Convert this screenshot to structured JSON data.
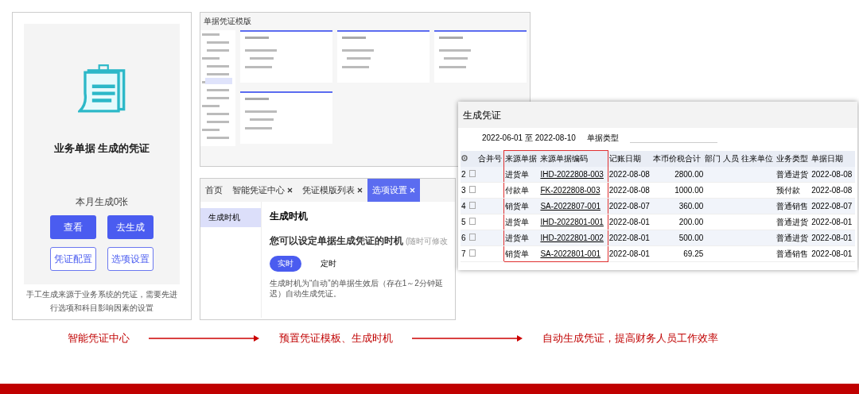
{
  "center_card": {
    "title": "业务单据 生成的凭证",
    "count": "本月生成0张",
    "buttons": [
      {
        "label": "查看",
        "kind": "primary"
      },
      {
        "label": "去生成",
        "kind": "primary"
      },
      {
        "label": "凭证配置",
        "kind": "outline"
      },
      {
        "label": "选项设置",
        "kind": "outline"
      }
    ],
    "note": "手工生成来源于业务系统的凭证，需要先进行选项和科目影响因素的设置"
  },
  "template_window": {
    "title": "单据凭证模版"
  },
  "options_window": {
    "tabs": [
      {
        "label": "首页",
        "closable": false,
        "selected": false
      },
      {
        "label": "智能凭证中心",
        "closable": true,
        "selected": false
      },
      {
        "label": "凭证模版列表",
        "closable": true,
        "selected": false
      },
      {
        "label": "选项设置",
        "closable": true,
        "selected": true
      }
    ],
    "sidebar": [
      {
        "label": "生成时机",
        "selected": true
      }
    ],
    "heading": "生成时机",
    "question": "您可以设定单据生成凭证的时机",
    "hint": "(随时可修改",
    "modes": [
      {
        "label": "实时",
        "selected": true
      },
      {
        "label": "定时",
        "selected": false
      }
    ],
    "note": "生成时机为“自动”的单据生效后（存在1～2分钟延迟）自动生成凭证。"
  },
  "generate_window": {
    "title": "生成凭证",
    "date_range": "2022-06-01 至 2022-08-10",
    "filter_label": "单据类型",
    "table": {
      "columns": [
        "合并号",
        "来源单据",
        "来源单据编码",
        "记账日期",
        "本币价税合计",
        "部门",
        "人员",
        "往来单位",
        "业务类型",
        "单据日期"
      ],
      "rows": [
        {
          "index": "2",
          "checked": false,
          "source": "进货单",
          "code": "IHD-2022808-003",
          "date": "2022-08-08",
          "amount": "2800.00",
          "type": "普通进货",
          "doc_date": "2022-08-08"
        },
        {
          "index": "3",
          "checked": false,
          "source": "付款单",
          "code": "FK-2022808-003",
          "date": "2022-08-08",
          "amount": "1000.00",
          "type": "预付款",
          "doc_date": "2022-08-08"
        },
        {
          "index": "4",
          "checked": false,
          "source": "销货单",
          "code": "SA-2022807-001",
          "date": "2022-08-07",
          "amount": "360.00",
          "type": "普通销售",
          "doc_date": "2022-08-07"
        },
        {
          "index": "5",
          "checked": false,
          "source": "进货单",
          "code": "IHD-2022801-001",
          "date": "2022-08-01",
          "amount": "200.00",
          "type": "普通进货",
          "doc_date": "2022-08-01"
        },
        {
          "index": "6",
          "checked": false,
          "source": "进货单",
          "code": "IHD-2022801-002",
          "date": "2022-08-01",
          "amount": "500.00",
          "type": "普通进货",
          "doc_date": "2022-08-01"
        },
        {
          "index": "7",
          "checked": false,
          "source": "销货单",
          "code": "SA-2022801-001",
          "date": "2022-08-01",
          "amount": "69.25",
          "type": "普通销售",
          "doc_date": "2022-08-01"
        }
      ]
    }
  },
  "captions": [
    "智能凭证中心",
    "预置凭证模板、生成时机",
    "自动生成凭证，提高财务人员工作效率"
  ]
}
